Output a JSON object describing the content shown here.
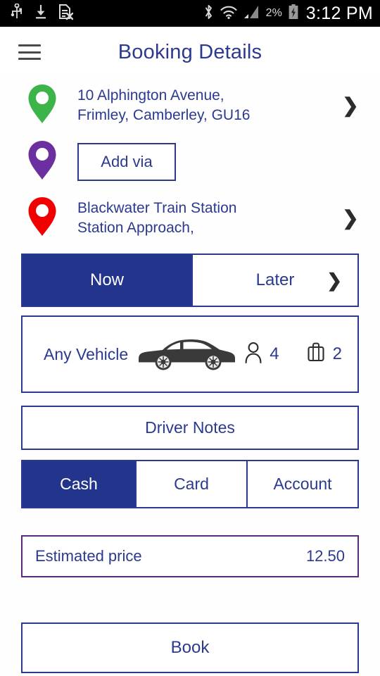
{
  "status_bar": {
    "left_icons": [
      "usb-icon",
      "download-icon",
      "sim-card-error-icon"
    ],
    "right_icons": [
      "bluetooth-icon",
      "wifi-icon",
      "cellular-signal-icon"
    ],
    "battery_percent": "2%",
    "battery_state": "charging",
    "time": "3:12 PM"
  },
  "header": {
    "menu_icon": "hamburger-menu-icon",
    "title": "Booking Details"
  },
  "route": {
    "pickup": {
      "pin_icon": "map-pin-green-icon",
      "pin_color": "#3cb44a",
      "line1": "10 Alphington Avenue,",
      "line2": "Frimley, Camberley, GU16",
      "chevron": "❯"
    },
    "via": {
      "pin_icon": "map-pin-purple-icon",
      "pin_color": "#6b2fa0",
      "button_label": "Add via"
    },
    "destination": {
      "pin_icon": "map-pin-red-icon",
      "pin_color": "#f20000",
      "line1": "Blackwater Train Station",
      "line2": "Station Approach,",
      "chevron": "❯"
    }
  },
  "time_selector": {
    "options": [
      {
        "label": "Now",
        "selected": true
      },
      {
        "label": "Later",
        "selected": false
      }
    ],
    "chevron": "❯"
  },
  "vehicle": {
    "label": "Any Vehicle",
    "vehicle_icon": "sedan-car-icon",
    "passenger_icon": "person-icon",
    "passenger_count": "4",
    "luggage_icon": "suitcase-icon",
    "luggage_count": "2"
  },
  "driver_notes": {
    "label": "Driver Notes"
  },
  "payment": {
    "options": [
      {
        "label": "Cash",
        "selected": true
      },
      {
        "label": "Card",
        "selected": false
      },
      {
        "label": "Account",
        "selected": false
      }
    ]
  },
  "price": {
    "label": "Estimated price",
    "value": "12.50",
    "border_color": "#5c2a79"
  },
  "book": {
    "label": "Book"
  },
  "theme": {
    "primary": "#23348c",
    "text_blue": "#2b3a8f",
    "background": "#ffffff"
  }
}
